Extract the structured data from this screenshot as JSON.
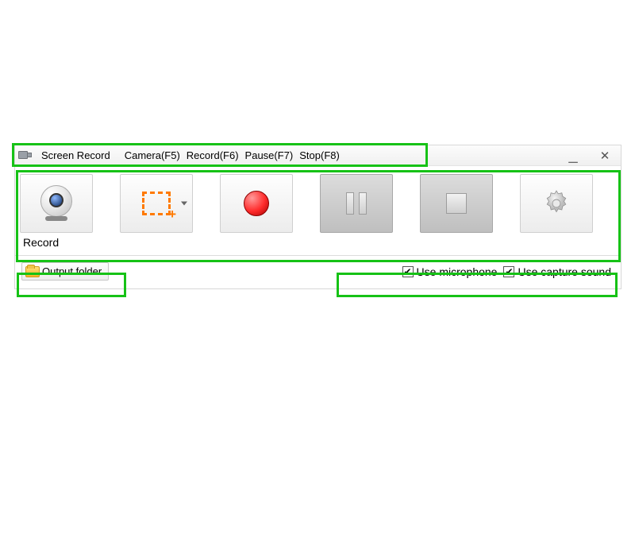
{
  "highlight_color": "#16c216",
  "titlebar": {
    "app_name": "Screen Record",
    "menu": {
      "camera": "Camera(F5)",
      "record": "Record(F6)",
      "pause": "Pause(F7)",
      "stop": "Stop(F8)"
    }
  },
  "window_controls": {
    "minimize": "__",
    "close": "✕"
  },
  "toolbar": {
    "buttons": [
      {
        "name": "webcam-button",
        "icon": "webcam-icon",
        "enabled": true
      },
      {
        "name": "crop-region-button",
        "icon": "crop-icon",
        "enabled": true,
        "has_dropdown": true
      },
      {
        "name": "record-button",
        "icon": "record-dot-icon",
        "enabled": true
      },
      {
        "name": "pause-button",
        "icon": "pause-icon",
        "enabled": false
      },
      {
        "name": "stop-button",
        "icon": "stop-icon",
        "enabled": false
      },
      {
        "name": "settings-button",
        "icon": "gear-icon",
        "enabled": true
      }
    ]
  },
  "status_label": "Record",
  "options": {
    "output_folder_label": "Output folder",
    "use_microphone": {
      "label": "Use microphone",
      "checked": true
    },
    "use_capture_sound": {
      "label": "Use capture sound",
      "checked": true
    }
  }
}
